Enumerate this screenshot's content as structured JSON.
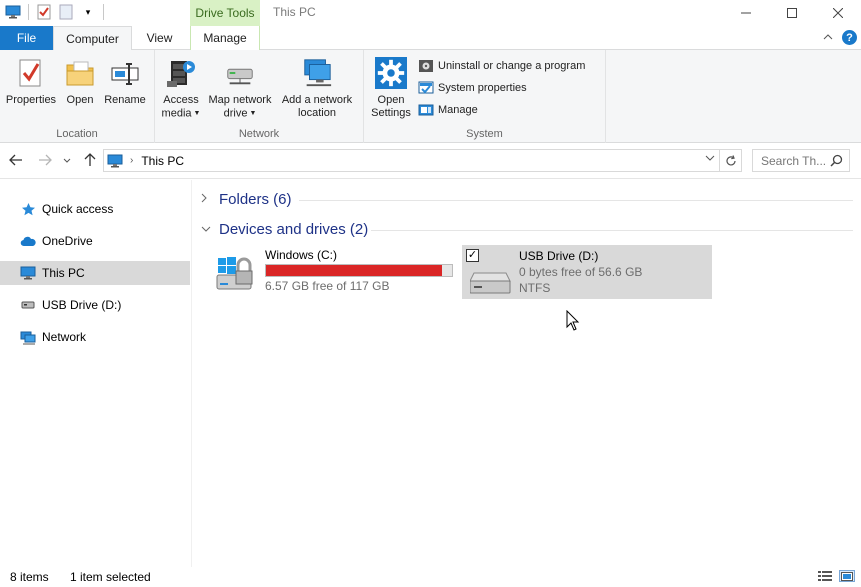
{
  "window": {
    "title": "This PC",
    "context_tab_group": "Drive Tools"
  },
  "tabs": {
    "file": "File",
    "computer": "Computer",
    "view": "View",
    "manage": "Manage"
  },
  "ribbon": {
    "location": {
      "label": "Location",
      "properties": "Properties",
      "open": "Open",
      "rename": "Rename"
    },
    "network": {
      "label": "Network",
      "access_media_1": "Access",
      "access_media_2": "media",
      "map_drive_1": "Map network",
      "map_drive_2": "drive",
      "add_location_1": "Add a network",
      "add_location_2": "location"
    },
    "system": {
      "label": "System",
      "open_settings_1": "Open",
      "open_settings_2": "Settings",
      "uninstall": "Uninstall or change a program",
      "system_properties": "System properties",
      "manage": "Manage"
    }
  },
  "address": {
    "crumb": "This PC",
    "search_placeholder": "Search Th..."
  },
  "nav": {
    "items": [
      {
        "label": "Quick access"
      },
      {
        "label": "OneDrive"
      },
      {
        "label": "This PC"
      },
      {
        "label": "USB Drive (D:)"
      },
      {
        "label": "Network"
      }
    ]
  },
  "content": {
    "folders_header": "Folders (6)",
    "devices_header": "Devices and drives (2)",
    "drives": [
      {
        "name": "Windows (C:)",
        "free": "6.57 GB free of 117 GB",
        "used_fraction": 0.944
      },
      {
        "name": "USB Drive (D:)",
        "free": "0 bytes free of 56.6 GB",
        "fs": "NTFS"
      }
    ]
  },
  "status": {
    "items": "8 items",
    "selected": "1 item selected"
  },
  "colors": {
    "accent": "#1979ca",
    "drive_tools_bg": "#d9f1c5",
    "usage_fill": "#da2626",
    "section_text": "#1e3287",
    "selection": "#d9d9d9"
  }
}
